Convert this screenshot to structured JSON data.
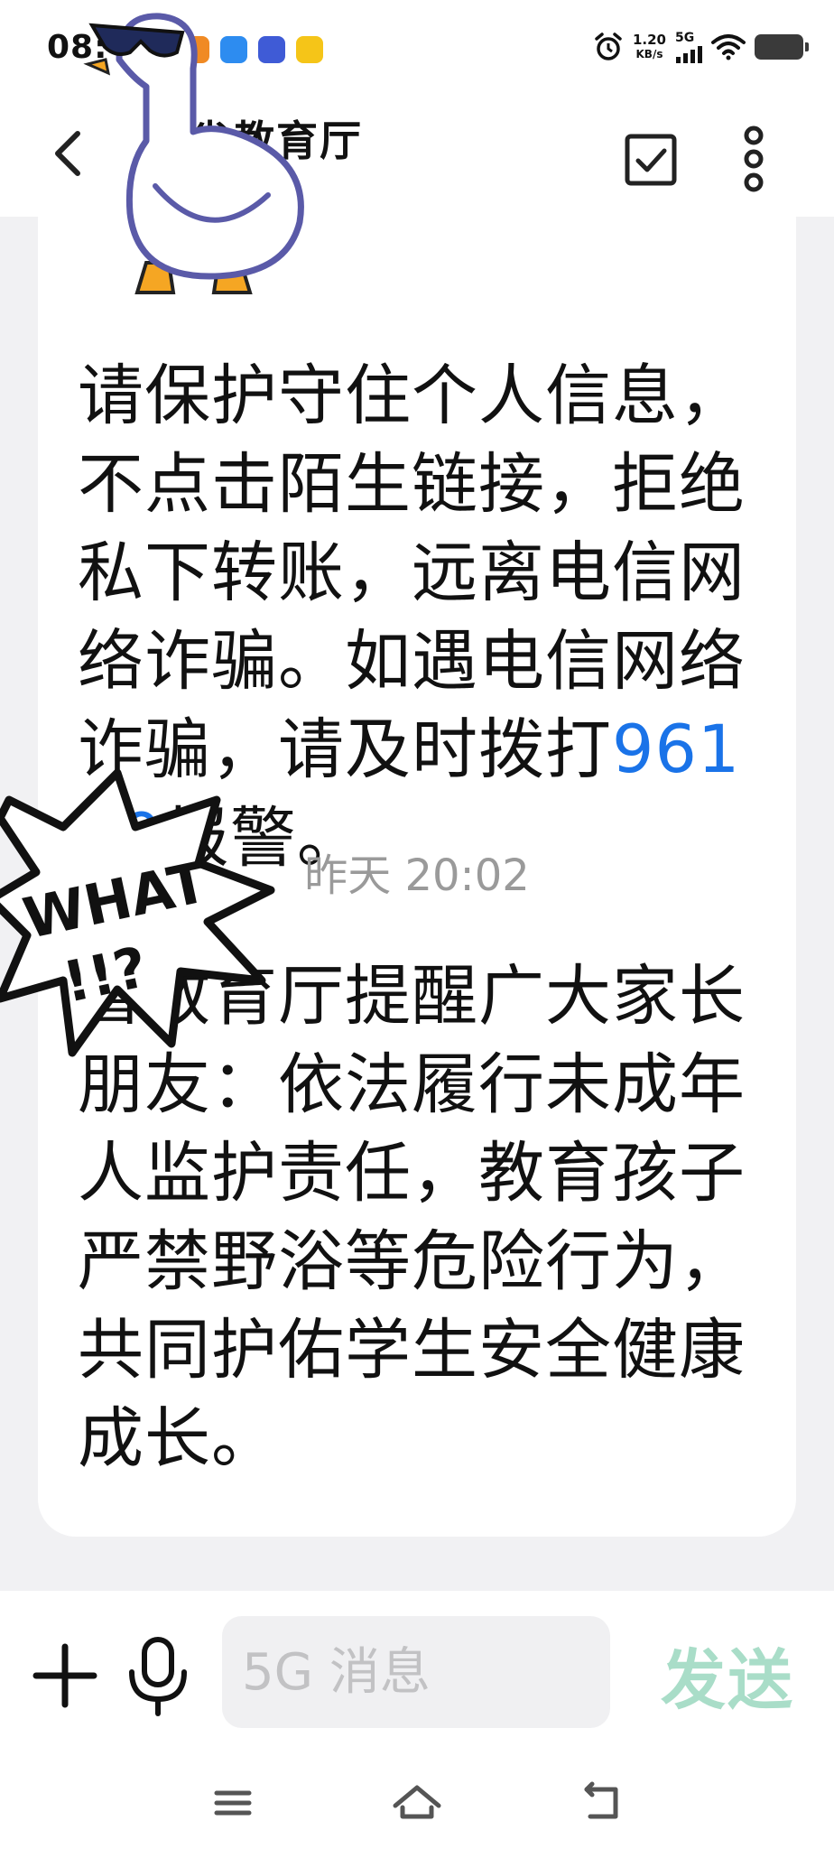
{
  "status_bar": {
    "time": "08:",
    "net_speed_value": "1.20",
    "net_speed_unit": "KB/s",
    "network": "5G"
  },
  "header": {
    "title": "省教育厅",
    "back_icon": "chevron-left-icon",
    "select_icon": "checkbox-icon",
    "more_icon": "more-vertical-icon"
  },
  "messages": [
    {
      "text_before": "请保护守住个人信息，不点击陌生链接，拒绝私下转账，远离电信网络诈骗。如遇电信网络诈骗，请及时拨打",
      "link": "96110",
      "text_after": "报警。"
    },
    {
      "timestamp": "昨天 20:02",
      "text": "省教育厅提醒广大家长朋友：依法履行未成年人监护责任，教育孩子严禁野浴等危险行为，共同护佑学生安全健康成长。"
    }
  ],
  "input_bar": {
    "placeholder": "5G 消息",
    "send_label": "发送"
  },
  "stickers": {
    "bubble_text": "WHAT !!?"
  },
  "colors": {
    "link": "#1a73e8",
    "send_disabled": "#a9ddc8",
    "background": "#f1f1f3"
  }
}
